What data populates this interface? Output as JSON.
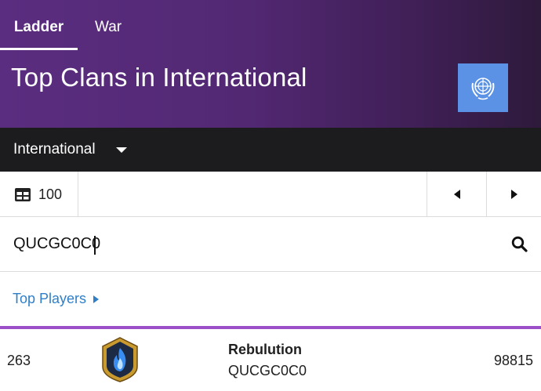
{
  "tabs": [
    {
      "label": "Ladder",
      "active": true
    },
    {
      "label": "War",
      "active": false
    }
  ],
  "hero": {
    "title": "Top Clans in International",
    "flag_icon": "united-nations-flag-icon"
  },
  "location": {
    "selected": "International",
    "icon": "chevron-down-icon"
  },
  "pager": {
    "page_size": "100",
    "icons": [
      "table-icon",
      "chevron-left-icon",
      "chevron-right-icon"
    ]
  },
  "search": {
    "value": "QUCGC0C0",
    "icon": "search-icon"
  },
  "links": {
    "top_players": "Top Players"
  },
  "clans": [
    {
      "rank": "263",
      "name": "Rebulution",
      "tag": "QUCGC0C0",
      "score": "98815",
      "badge_icon": "clan-badge-blue-flame-icon"
    }
  ],
  "colors": {
    "hero_gradient_start": "#5b2d80",
    "hero_gradient_end": "#2e1a3b",
    "location_bar": "#1c1c1e",
    "link": "#2f7fc8",
    "divider": "#9b4fc8",
    "flag_blue": "#5b92e5"
  }
}
